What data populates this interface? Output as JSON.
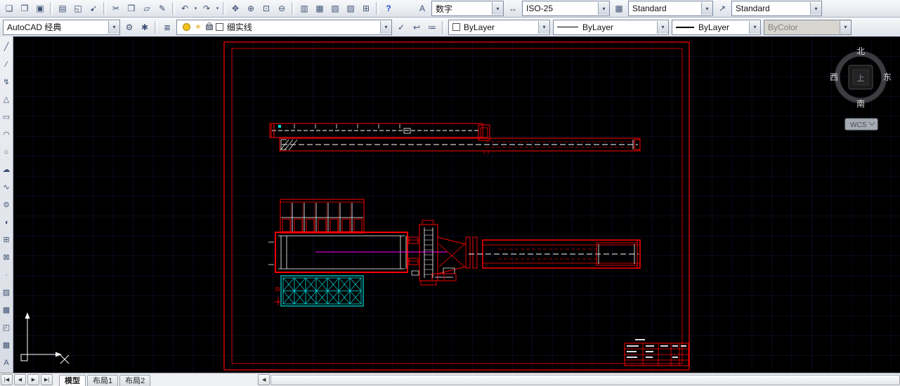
{
  "ui": {
    "dropdown_arrow": "▾"
  },
  "toolbar_top": {
    "icons": [
      {
        "name": "new",
        "glyph": "❏"
      },
      {
        "name": "open",
        "glyph": "❐"
      },
      {
        "name": "save",
        "glyph": "▣"
      },
      {
        "name": "plot",
        "glyph": "▤"
      },
      {
        "name": "plot-preview",
        "glyph": "◱"
      },
      {
        "name": "publish",
        "glyph": "➹"
      },
      {
        "name": "cut",
        "glyph": "✂"
      },
      {
        "name": "copy",
        "glyph": "❒"
      },
      {
        "name": "paste",
        "glyph": "▱"
      },
      {
        "name": "match-properties",
        "glyph": "✎"
      },
      {
        "name": "undo",
        "glyph": "↶"
      },
      {
        "name": "redo",
        "glyph": "↷"
      },
      {
        "name": "pan",
        "glyph": "✥"
      },
      {
        "name": "zoom-realtime",
        "glyph": "⊕"
      },
      {
        "name": "zoom-window",
        "glyph": "⊡"
      },
      {
        "name": "zoom-previous",
        "glyph": "⊖"
      },
      {
        "name": "properties",
        "glyph": "▥"
      },
      {
        "name": "design-center",
        "glyph": "▦"
      },
      {
        "name": "tool-palettes",
        "glyph": "▧"
      },
      {
        "name": "sheet-set-manager",
        "glyph": "▨"
      },
      {
        "name": "quick-calc",
        "glyph": "⊞"
      },
      {
        "name": "help",
        "glyph": "?"
      }
    ],
    "style_groups": [
      {
        "name": "text-style",
        "button_glyph": "A",
        "value": "数字"
      },
      {
        "name": "dim-style",
        "button_glyph": "↔",
        "value": "ISO-25"
      },
      {
        "name": "table-style",
        "button_glyph": "▦",
        "value": "Standard"
      },
      {
        "name": "multileader-style",
        "button_glyph": "↗",
        "value": "Standard"
      }
    ]
  },
  "toolbar_second": {
    "workspace": {
      "value": "AutoCAD 经典"
    },
    "buttons": {
      "settings_glyph": "⚙",
      "my_workspace_glyph": "✱",
      "layer_manager_glyph": "≣",
      "make_current_glyph": "✓",
      "layer_previous_glyph": "↩",
      "layer_states_glyph": "≔"
    },
    "layer": {
      "sun_glyph": "☀",
      "name": "细实线"
    },
    "color": {
      "value": "ByLayer"
    },
    "linetype": {
      "value": "ByLayer"
    },
    "lineweight": {
      "value": "ByLayer"
    },
    "plot_style": {
      "value": "ByColor"
    }
  },
  "draw_toolbar": {
    "icons": [
      {
        "name": "line",
        "glyph": "╱"
      },
      {
        "name": "construction-line",
        "glyph": "∕"
      },
      {
        "name": "polyline",
        "glyph": "↯"
      },
      {
        "name": "polygon",
        "glyph": "△"
      },
      {
        "name": "rectangle",
        "glyph": "▭"
      },
      {
        "name": "arc",
        "glyph": "◠"
      },
      {
        "name": "circle",
        "glyph": "○"
      },
      {
        "name": "revision-cloud",
        "glyph": "☁"
      },
      {
        "name": "spline",
        "glyph": "∿"
      },
      {
        "name": "ellipse",
        "glyph": "⊜"
      },
      {
        "name": "ellipse-arc",
        "glyph": "◖"
      },
      {
        "name": "insert-block",
        "glyph": "⊞"
      },
      {
        "name": "create-block",
        "glyph": "⊠"
      },
      {
        "name": "point",
        "glyph": "∙"
      },
      {
        "name": "hatch",
        "glyph": "▨"
      },
      {
        "name": "gradient",
        "glyph": "▩"
      },
      {
        "name": "region",
        "glyph": "◰"
      },
      {
        "name": "table",
        "glyph": "▦"
      },
      {
        "name": "multiline-text",
        "glyph": "A"
      }
    ]
  },
  "canvas": {
    "navigation": {
      "north": "北",
      "south": "南",
      "west": "西",
      "east": "东",
      "top_face": "上",
      "wcs_label": "WCS"
    },
    "colors": {
      "background": "#000000",
      "grid": "#14143a",
      "outline_red": "#ff0000",
      "detail_white": "#ffffff",
      "hatch_cyan": "#00e0e0",
      "centerline_magenta": "#ff00ff"
    }
  },
  "bottom_bar": {
    "nav": {
      "first": "|◀",
      "prev": "◀",
      "next": "▶",
      "last": "▶|"
    },
    "tabs": [
      {
        "label": "模型",
        "active": true
      },
      {
        "label": "布局1",
        "active": false
      },
      {
        "label": "布局2",
        "active": false
      }
    ],
    "scroll_left": "◀"
  }
}
